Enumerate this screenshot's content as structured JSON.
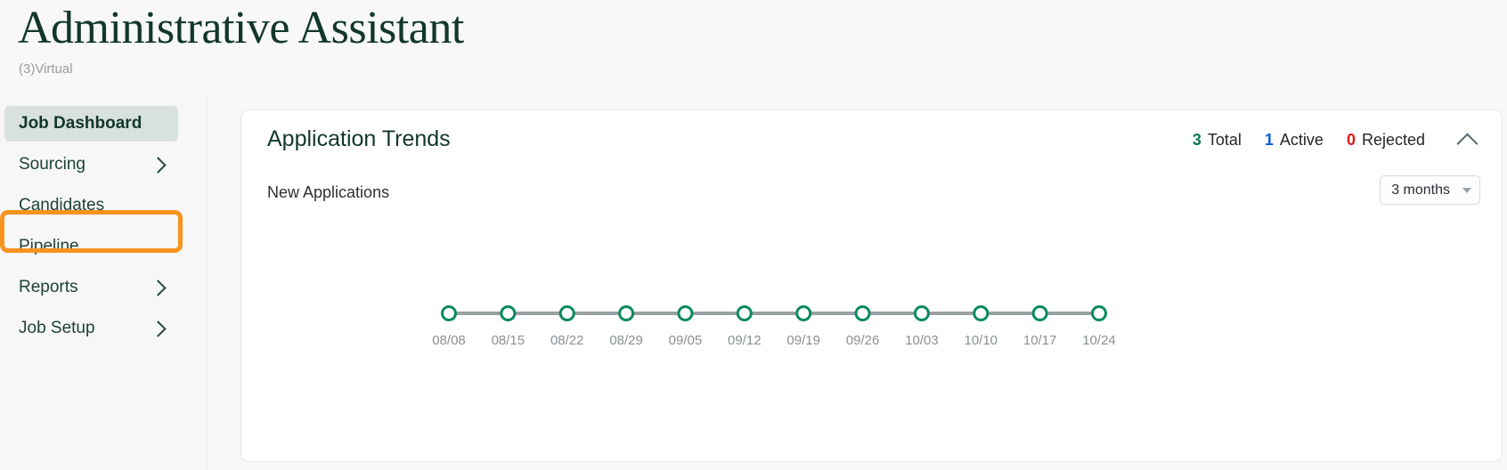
{
  "header": {
    "title": "Administrative Assistant",
    "subtitle": "(3)Virtual"
  },
  "sidebar": {
    "items": [
      {
        "label": "Job Dashboard",
        "active": true,
        "has_chevron": false
      },
      {
        "label": "Sourcing",
        "active": false,
        "has_chevron": true
      },
      {
        "label": "Candidates",
        "active": false,
        "has_chevron": false
      },
      {
        "label": "Pipeline",
        "active": false,
        "has_chevron": false
      },
      {
        "label": "Reports",
        "active": false,
        "has_chevron": true
      },
      {
        "label": "Job Setup",
        "active": false,
        "has_chevron": true
      }
    ],
    "highlighted_item": "Job Setup",
    "highlight_color": "#f7941e",
    "active_bg_color": "#d8e1db"
  },
  "card": {
    "title": "Application Trends",
    "stats": [
      {
        "value": "3",
        "label": "Total",
        "color": "#0a7a52"
      },
      {
        "value": "1",
        "label": "Active",
        "color": "#0b5ed7"
      },
      {
        "value": "0",
        "label": "Rejected",
        "color": "#e01b1b"
      }
    ],
    "collapse_icon": "chevron-up-icon",
    "series_label": "New Applications",
    "range_select": {
      "value": "3 months",
      "caret": "caret-down-icon"
    }
  },
  "chart_data": {
    "type": "line",
    "title": "New Applications",
    "xlabel": "",
    "ylabel": "",
    "grid": false,
    "legend": false,
    "categories": [
      "08/08",
      "08/15",
      "08/22",
      "08/29",
      "09/05",
      "09/12",
      "09/19",
      "09/26",
      "10/03",
      "10/10",
      "10/17",
      "10/24"
    ],
    "series": [
      {
        "name": "New Applications",
        "values": [
          0,
          0,
          0,
          0,
          0,
          0,
          0,
          0,
          0,
          0,
          0,
          0
        ],
        "line_color": "#9aa0a3",
        "marker_color": "#0a8a5f",
        "marker_fill": "#ffffff"
      }
    ],
    "ylim": [
      0,
      1
    ]
  }
}
